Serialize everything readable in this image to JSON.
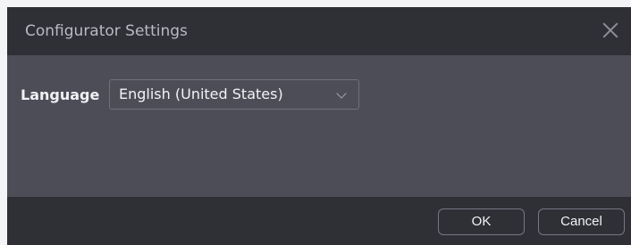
{
  "dialog": {
    "title": "Configurator Settings",
    "close_icon": "close-icon"
  },
  "language": {
    "label": "Language",
    "selected": "English (United States)",
    "dropdown_icon": "chevron-down-icon"
  },
  "footer": {
    "ok_label": "OK",
    "cancel_label": "Cancel"
  },
  "colors": {
    "titlebar_background": "#2F3036",
    "dialog_background": "#4C4D57",
    "border": "#767781",
    "text": "#F2F2F5"
  }
}
